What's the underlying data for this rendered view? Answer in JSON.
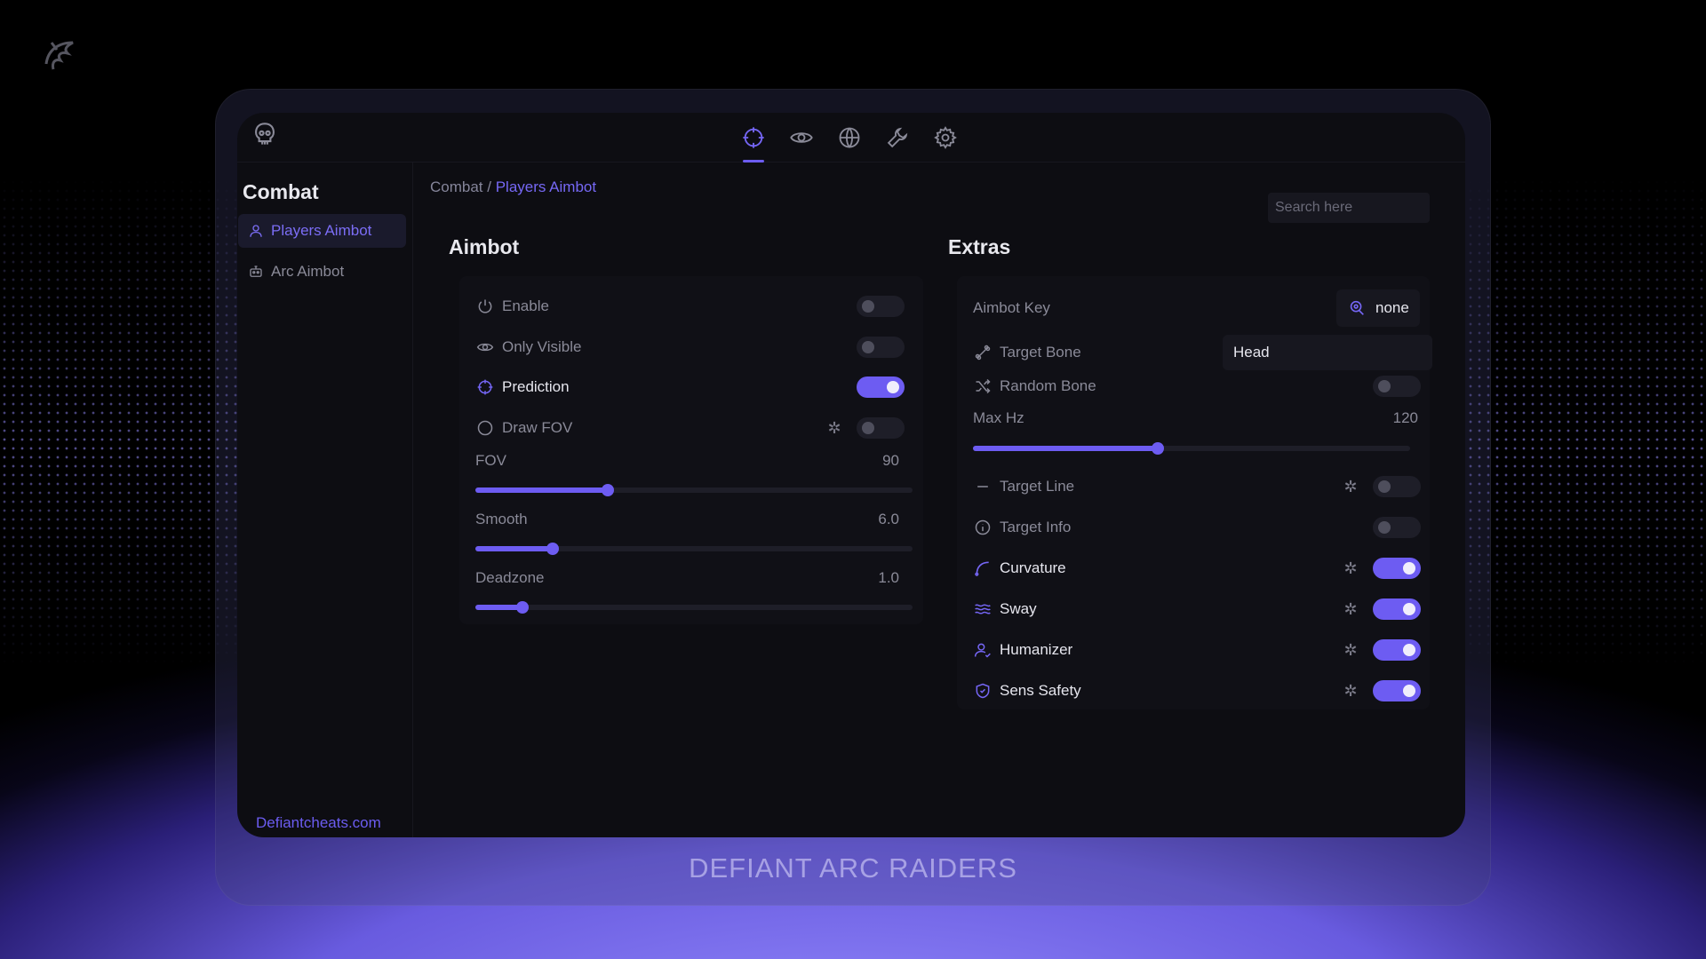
{
  "brand": {
    "footer": "DEFIANT ARC RAIDERS",
    "site": "Defiantcheats.com"
  },
  "topnav": {
    "active": "crosshair",
    "items": [
      {
        "icon": "crosshair-icon"
      },
      {
        "icon": "eye-icon"
      },
      {
        "icon": "globe-icon"
      },
      {
        "icon": "wrench-icon"
      },
      {
        "icon": "gear-icon"
      }
    ]
  },
  "sidebar": {
    "title": "Combat",
    "items": [
      {
        "label": "Players Aimbot",
        "icon": "user-icon",
        "active": true
      },
      {
        "label": "Arc Aimbot",
        "icon": "robot-icon",
        "active": false
      }
    ]
  },
  "breadcrumb": {
    "root": "Combat",
    "separator": " / ",
    "current": "Players Aimbot"
  },
  "search": {
    "placeholder": "Search here",
    "value": ""
  },
  "aimbot": {
    "title": "Aimbot",
    "toggles": [
      {
        "label": "Enable",
        "icon": "power-icon",
        "on": false
      },
      {
        "label": "Only Visible",
        "icon": "eye-icon",
        "on": false
      },
      {
        "label": "Prediction",
        "icon": "crosshair-icon",
        "on": true
      },
      {
        "label": "Draw FOV",
        "icon": "circle-icon",
        "on": false,
        "has_settings": true
      }
    ],
    "sliders": [
      {
        "label": "FOV",
        "value": "90",
        "fraction": 0.3
      },
      {
        "label": "Smooth",
        "value": "6.0",
        "fraction": 0.175
      },
      {
        "label": "Deadzone",
        "value": "1.0",
        "fraction": 0.105
      }
    ]
  },
  "extras": {
    "title": "Extras",
    "aimbot_key": {
      "label": "Aimbot Key",
      "value": "none",
      "icon": "keyboard-icon"
    },
    "target_bone": {
      "label": "Target Bone",
      "value": "Head",
      "icon": "bone-icon"
    },
    "random_bone": {
      "label": "Random Bone",
      "icon": "shuffle-icon",
      "on": false
    },
    "max_hz": {
      "label": "Max Hz",
      "value": "120",
      "fraction": 0.42
    },
    "toggles": [
      {
        "label": "Target Line",
        "icon": "line-icon",
        "on": false,
        "has_settings": true
      },
      {
        "label": "Target Info",
        "icon": "info-icon",
        "on": false,
        "has_settings": false
      },
      {
        "label": "Curvature",
        "icon": "curve-icon",
        "on": true,
        "has_settings": true
      },
      {
        "label": "Sway",
        "icon": "wave-icon",
        "on": true,
        "has_settings": true
      },
      {
        "label": "Humanizer",
        "icon": "person-icon",
        "on": true,
        "has_settings": true
      },
      {
        "label": "Sens Safety",
        "icon": "shield-icon",
        "on": true,
        "has_settings": true
      }
    ]
  },
  "colors": {
    "accent": "#6d5cf2",
    "window_bg": "#0d0d12",
    "glow": "#7b6df5"
  }
}
